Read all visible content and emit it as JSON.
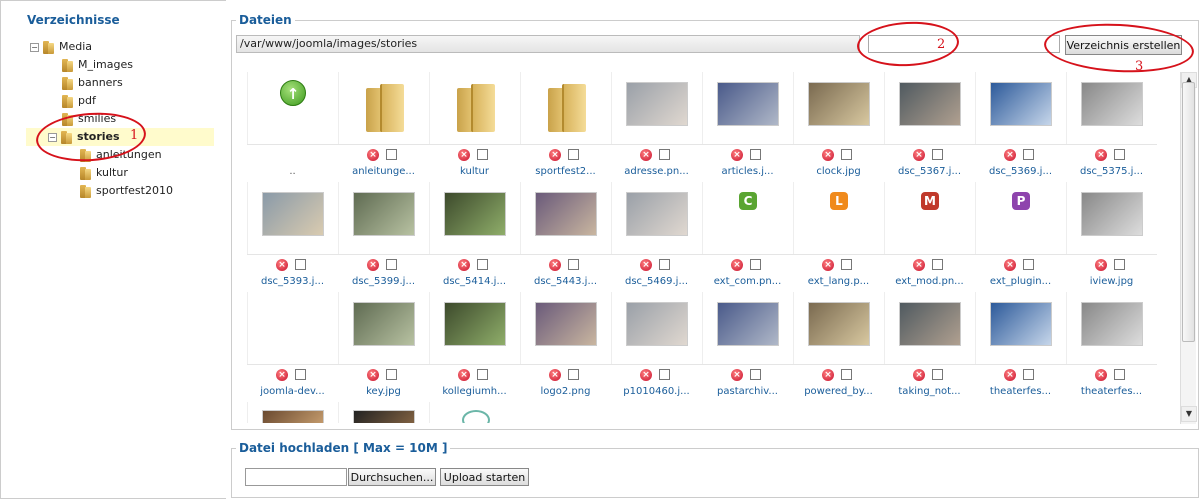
{
  "left_panel": {
    "title": "Verzeichnisse",
    "tree": [
      {
        "label": "Media",
        "level": 0,
        "expanded": true
      },
      {
        "label": "M_images",
        "level": 1
      },
      {
        "label": "banners",
        "level": 1
      },
      {
        "label": "pdf",
        "level": 1
      },
      {
        "label": "smilies",
        "level": 1
      },
      {
        "label": "stories",
        "level": 1,
        "expanded": true,
        "selected": true
      },
      {
        "label": "anleitungen",
        "level": 2
      },
      {
        "label": "kultur",
        "level": 2
      },
      {
        "label": "sportfest2010",
        "level": 2
      }
    ]
  },
  "files": {
    "legend": "Dateien",
    "path": "/var/www/joomla/images/stories",
    "new_folder_value": "",
    "create_button": "Verzeichnis erstellen",
    "items": [
      {
        "name": "..",
        "kind": "up"
      },
      {
        "name": "anleitunge...",
        "kind": "folder"
      },
      {
        "name": "kultur",
        "kind": "folder"
      },
      {
        "name": "sportfest2...",
        "kind": "folder"
      },
      {
        "name": "adresse.pn...",
        "kind": "image"
      },
      {
        "name": "articles.j...",
        "kind": "image"
      },
      {
        "name": "clock.jpg",
        "kind": "image"
      },
      {
        "name": "dsc_5367.j...",
        "kind": "image"
      },
      {
        "name": "dsc_5369.j...",
        "kind": "image"
      },
      {
        "name": "dsc_5375.j...",
        "kind": "image"
      },
      {
        "name": "dsc_5393.j...",
        "kind": "image"
      },
      {
        "name": "dsc_5399.j...",
        "kind": "image"
      },
      {
        "name": "dsc_5414.j...",
        "kind": "image"
      },
      {
        "name": "dsc_5443.j...",
        "kind": "image"
      },
      {
        "name": "dsc_5469.j...",
        "kind": "image"
      },
      {
        "name": "ext_com.pn...",
        "kind": "letter",
        "letter": "C",
        "color": "#5aa532"
      },
      {
        "name": "ext_lang.p...",
        "kind": "letter",
        "letter": "L",
        "color": "#f08a1c"
      },
      {
        "name": "ext_mod.pn...",
        "kind": "letter",
        "letter": "M",
        "color": "#c0392b"
      },
      {
        "name": "ext_plugin...",
        "kind": "letter",
        "letter": "P",
        "color": "#8e44ad"
      },
      {
        "name": "iview.jpg",
        "kind": "image"
      },
      {
        "name": "joomla-dev...",
        "kind": "blank"
      },
      {
        "name": "key.jpg",
        "kind": "image"
      },
      {
        "name": "kollegiumh...",
        "kind": "image"
      },
      {
        "name": "logo2.png",
        "kind": "image"
      },
      {
        "name": "p1010460.j...",
        "kind": "image"
      },
      {
        "name": "pastarchiv...",
        "kind": "image"
      },
      {
        "name": "powered_by...",
        "kind": "image"
      },
      {
        "name": "taking_not...",
        "kind": "image"
      },
      {
        "name": "theaterfes...",
        "kind": "image"
      },
      {
        "name": "theaterfes...",
        "kind": "image"
      }
    ]
  },
  "upload": {
    "legend": "Datei hochladen [ Max = 10M ]",
    "browse_button": "Durchsuchen...",
    "start_button": "Upload starten"
  },
  "annotations": [
    "1",
    "2",
    "3"
  ],
  "colors": {
    "accent": "#1a5d9a",
    "annotation": "#d6121b",
    "selected_row": "#fffbcc",
    "delete_icon": "#c8102e"
  }
}
